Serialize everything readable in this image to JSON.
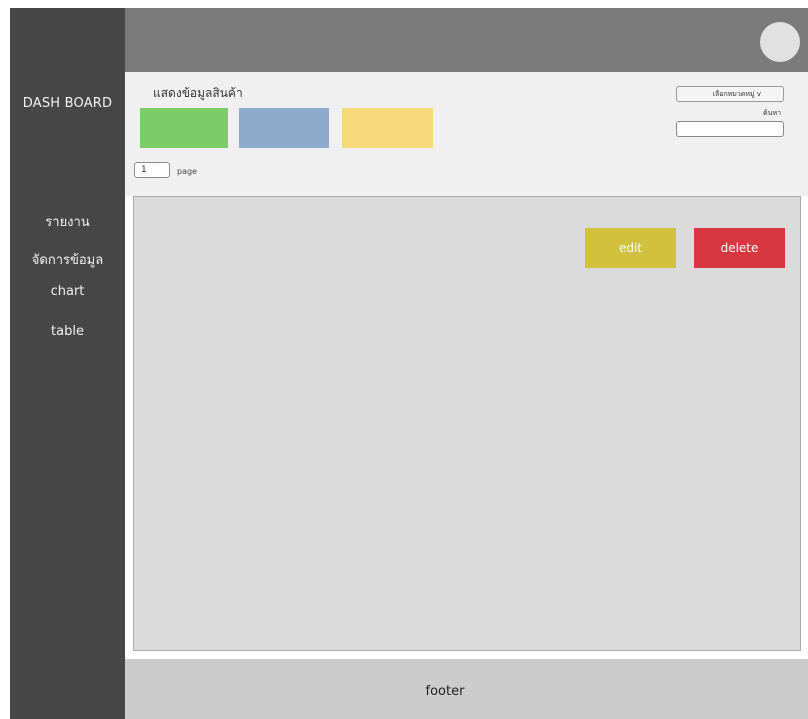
{
  "sidebar": {
    "brand": "DASH BOARD",
    "items": [
      {
        "label": "รายงาน"
      },
      {
        "label": "จัดการข้อมูล"
      },
      {
        "label": "chart"
      },
      {
        "label": "table"
      }
    ]
  },
  "header": {},
  "toppanel": {
    "heading": "แสดงข้อมูลสินค้า",
    "swatches": [
      {
        "color": "#7ccc6a"
      },
      {
        "color": "#8eaacb"
      },
      {
        "color": "#f6d978"
      }
    ],
    "page_value": "1",
    "page_label": "page",
    "category_select": "เลือกหมวดหมู่ v",
    "search_label": "ค้นหา",
    "search_value": ""
  },
  "content": {
    "edit_label": "edit",
    "delete_label": "delete",
    "edit_color": "#d2c13d",
    "delete_color": "#d7373e"
  },
  "footer": {
    "text": "footer"
  }
}
